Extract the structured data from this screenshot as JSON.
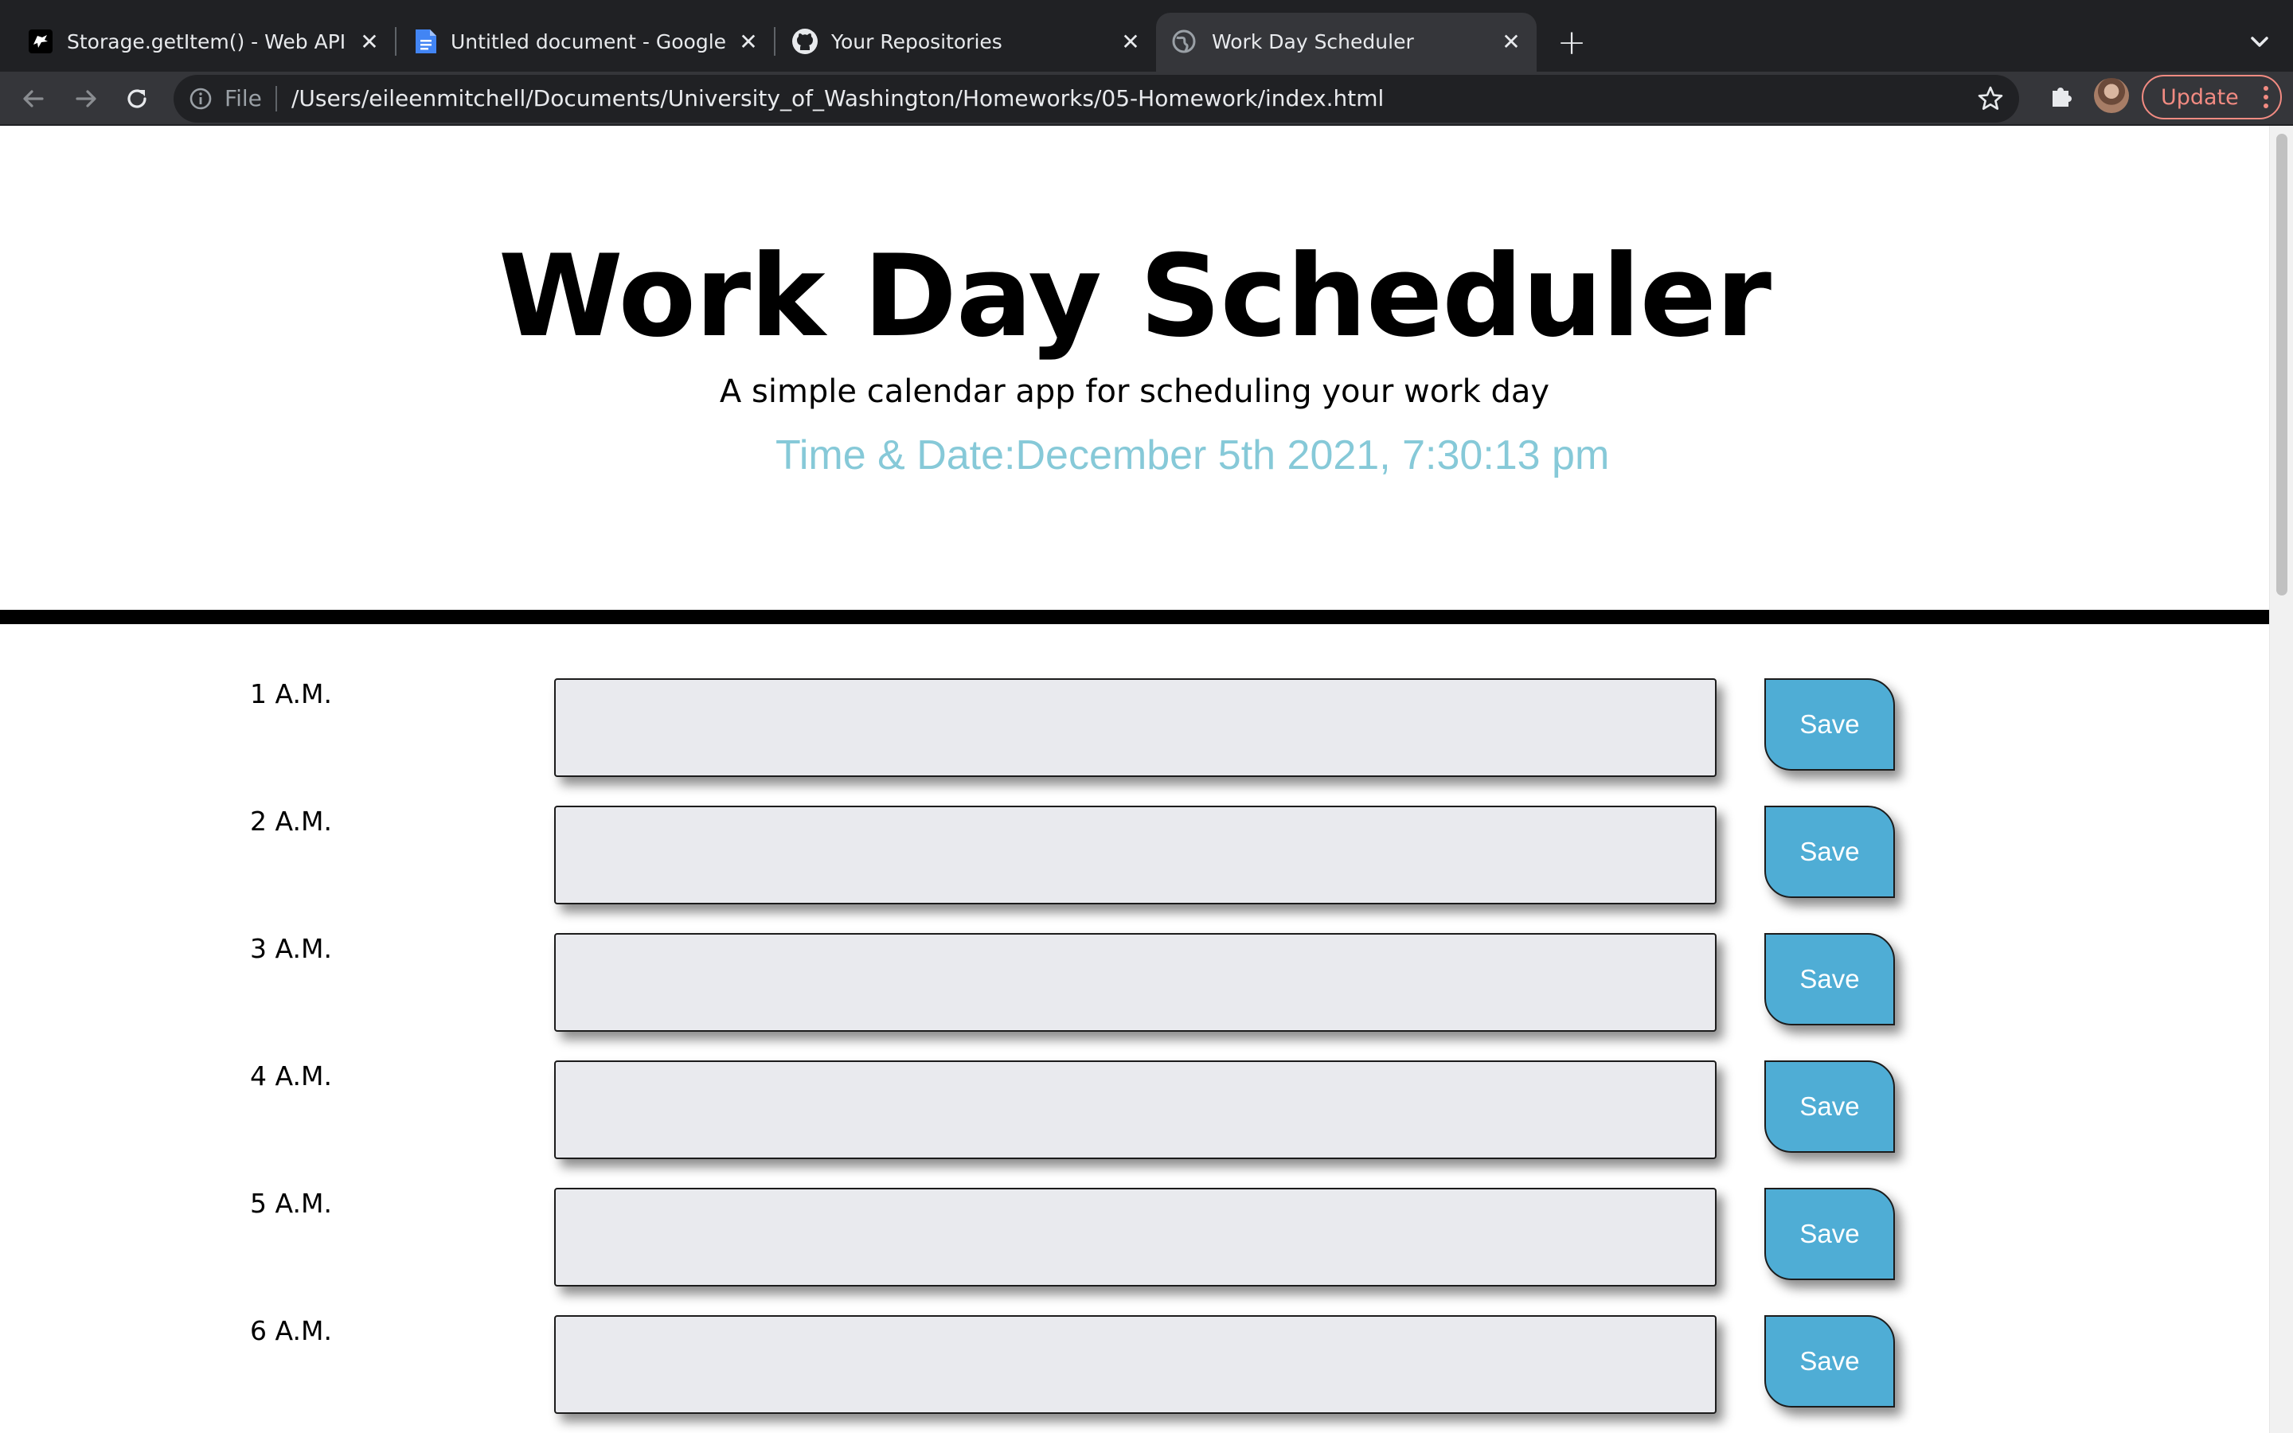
{
  "browser": {
    "tabs": [
      {
        "title": "Storage.getItem() - Web APIs |",
        "favicon": "mdn-dino-icon",
        "active": false
      },
      {
        "title": "Untitled document - Google Do",
        "favicon": "google-docs-icon",
        "active": false
      },
      {
        "title": "Your Repositories",
        "favicon": "github-icon",
        "active": false
      },
      {
        "title": "Work Day Scheduler",
        "favicon": "globe-icon",
        "active": true
      }
    ],
    "omnibox": {
      "scheme": "File",
      "url": "/Users/eileenmitchell/Documents/University_of_Washington/Homeworks/05-Homework/index.html"
    },
    "update_label": "Update",
    "accent_colors": {
      "chrome_dark": "#202124",
      "chrome_toolbar": "#35363a",
      "update": "#f28b82"
    }
  },
  "page": {
    "title": "Work Day Scheduler",
    "lead": "A simple calendar app for scheduling your work day",
    "datetime": "Time & Date:December 5th 2021, 7:30:13 pm",
    "colors": {
      "datetime": "#86c9d8",
      "save_button": "#4fadd5",
      "entry_bg": "#e9eaee"
    },
    "rows": [
      {
        "hour": "1 A.M.",
        "value": "",
        "save_label": "Save"
      },
      {
        "hour": "2 A.M.",
        "value": "",
        "save_label": "Save"
      },
      {
        "hour": "3 A.M.",
        "value": "",
        "save_label": "Save"
      },
      {
        "hour": "4 A.M.",
        "value": "",
        "save_label": "Save"
      },
      {
        "hour": "5 A.M.",
        "value": "",
        "save_label": "Save"
      },
      {
        "hour": "6 A.M.",
        "value": "",
        "save_label": "Save"
      }
    ]
  }
}
